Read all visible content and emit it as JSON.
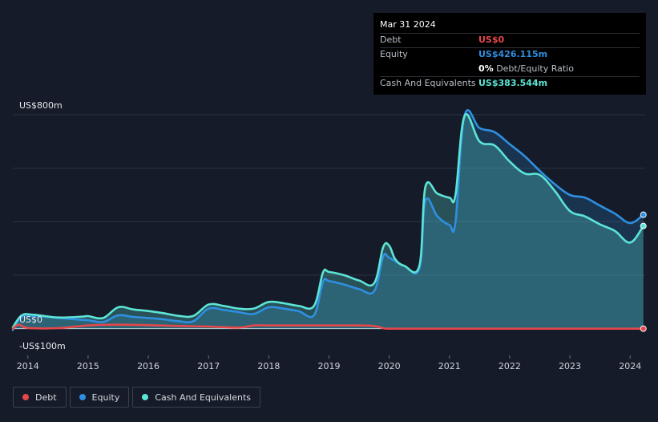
{
  "tooltip": {
    "date": "Mar 31 2024",
    "debt_label": "Debt",
    "debt_value": "US$0",
    "equity_label": "Equity",
    "equity_value": "US$426.115m",
    "ratio_value": "0%",
    "ratio_label": "Debt/Equity Ratio",
    "cash_label": "Cash And Equivalents",
    "cash_value": "US$383.544m"
  },
  "colors": {
    "debt": "#e5474b",
    "equity": "#2f8fe0",
    "cash": "#5ce4d6",
    "background": "#151b28",
    "grid": "#2c3340"
  },
  "chart_data": {
    "type": "area",
    "title": "",
    "xlabel": "",
    "ylabel": "",
    "ylim": [
      -100,
      800
    ],
    "ytick_labels": [
      {
        "value": 800,
        "label": "US$800m"
      },
      {
        "value": 0,
        "label": "US$0"
      },
      {
        "value": -100,
        "label": "-US$100m"
      }
    ],
    "gridlines": [
      0,
      200,
      400,
      600,
      800
    ],
    "xlim": [
      2013.75,
      2024.25
    ],
    "xticks": [
      2014,
      2015,
      2016,
      2017,
      2018,
      2019,
      2020,
      2021,
      2022,
      2023,
      2024
    ],
    "legend_position": "bottom-left",
    "series": [
      {
        "name": "Debt",
        "color": "#e5474b",
        "points": [
          [
            2013.75,
            0
          ],
          [
            2013.85,
            15
          ],
          [
            2014.0,
            3
          ],
          [
            2014.5,
            2
          ],
          [
            2015.0,
            12
          ],
          [
            2015.5,
            15
          ],
          [
            2016.0,
            13
          ],
          [
            2016.5,
            10
          ],
          [
            2017.0,
            8
          ],
          [
            2017.5,
            4
          ],
          [
            2017.75,
            12
          ],
          [
            2018.0,
            12
          ],
          [
            2018.5,
            12
          ],
          [
            2019.0,
            12
          ],
          [
            2019.5,
            12
          ],
          [
            2019.75,
            10
          ],
          [
            2019.9,
            2
          ],
          [
            2020.0,
            0
          ],
          [
            2020.5,
            0
          ],
          [
            2021.0,
            0
          ],
          [
            2021.5,
            0
          ],
          [
            2022.0,
            0
          ],
          [
            2022.5,
            0
          ],
          [
            2023.0,
            0
          ],
          [
            2023.5,
            0
          ],
          [
            2024.0,
            0
          ],
          [
            2024.22,
            0
          ]
        ]
      },
      {
        "name": "Equity",
        "color": "#2f8fe0",
        "points": [
          [
            2013.75,
            -5
          ],
          [
            2013.9,
            45
          ],
          [
            2014.1,
            48
          ],
          [
            2014.5,
            40
          ],
          [
            2014.9,
            33
          ],
          [
            2015.0,
            32
          ],
          [
            2015.25,
            25
          ],
          [
            2015.5,
            50
          ],
          [
            2015.75,
            44
          ],
          [
            2016.0,
            40
          ],
          [
            2016.25,
            35
          ],
          [
            2016.5,
            28
          ],
          [
            2016.75,
            28
          ],
          [
            2017.0,
            75
          ],
          [
            2017.25,
            70
          ],
          [
            2017.5,
            62
          ],
          [
            2017.75,
            55
          ],
          [
            2018.0,
            80
          ],
          [
            2018.25,
            75
          ],
          [
            2018.5,
            65
          ],
          [
            2018.75,
            50
          ],
          [
            2018.9,
            175
          ],
          [
            2019.0,
            178
          ],
          [
            2019.25,
            165
          ],
          [
            2019.5,
            148
          ],
          [
            2019.75,
            140
          ],
          [
            2019.9,
            270
          ],
          [
            2020.0,
            265
          ],
          [
            2020.25,
            235
          ],
          [
            2020.5,
            225
          ],
          [
            2020.6,
            478
          ],
          [
            2020.8,
            420
          ],
          [
            2021.0,
            388
          ],
          [
            2021.1,
            398
          ],
          [
            2021.25,
            796
          ],
          [
            2021.5,
            750
          ],
          [
            2021.75,
            735
          ],
          [
            2022.0,
            690
          ],
          [
            2022.25,
            645
          ],
          [
            2022.5,
            590
          ],
          [
            2022.75,
            540
          ],
          [
            2023.0,
            500
          ],
          [
            2023.25,
            490
          ],
          [
            2023.5,
            460
          ],
          [
            2023.75,
            430
          ],
          [
            2024.0,
            395
          ],
          [
            2024.22,
            426
          ]
        ]
      },
      {
        "name": "Cash And Equivalents",
        "color": "#5ce4d6",
        "points": [
          [
            2013.75,
            5
          ],
          [
            2013.9,
            50
          ],
          [
            2014.1,
            52
          ],
          [
            2014.5,
            42
          ],
          [
            2014.9,
            45
          ],
          [
            2015.0,
            47
          ],
          [
            2015.25,
            40
          ],
          [
            2015.5,
            80
          ],
          [
            2015.75,
            72
          ],
          [
            2016.0,
            66
          ],
          [
            2016.25,
            58
          ],
          [
            2016.5,
            48
          ],
          [
            2016.75,
            48
          ],
          [
            2017.0,
            90
          ],
          [
            2017.25,
            85
          ],
          [
            2017.5,
            75
          ],
          [
            2017.75,
            75
          ],
          [
            2018.0,
            100
          ],
          [
            2018.25,
            95
          ],
          [
            2018.5,
            85
          ],
          [
            2018.75,
            85
          ],
          [
            2018.9,
            210
          ],
          [
            2019.0,
            212
          ],
          [
            2019.25,
            200
          ],
          [
            2019.5,
            180
          ],
          [
            2019.75,
            170
          ],
          [
            2019.9,
            305
          ],
          [
            2020.0,
            310
          ],
          [
            2020.1,
            260
          ],
          [
            2020.25,
            235
          ],
          [
            2020.5,
            235
          ],
          [
            2020.6,
            530
          ],
          [
            2020.8,
            505
          ],
          [
            2021.0,
            490
          ],
          [
            2021.1,
            500
          ],
          [
            2021.25,
            795
          ],
          [
            2021.5,
            700
          ],
          [
            2021.75,
            685
          ],
          [
            2022.0,
            625
          ],
          [
            2022.25,
            580
          ],
          [
            2022.5,
            575
          ],
          [
            2022.75,
            515
          ],
          [
            2023.0,
            440
          ],
          [
            2023.25,
            420
          ],
          [
            2023.5,
            390
          ],
          [
            2023.75,
            365
          ],
          [
            2024.0,
            322
          ],
          [
            2024.22,
            384
          ]
        ]
      }
    ]
  },
  "legend": [
    {
      "label": "Debt",
      "color": "#e5474b"
    },
    {
      "label": "Equity",
      "color": "#2f8fe0"
    },
    {
      "label": "Cash And Equivalents",
      "color": "#5ce4d6"
    }
  ]
}
